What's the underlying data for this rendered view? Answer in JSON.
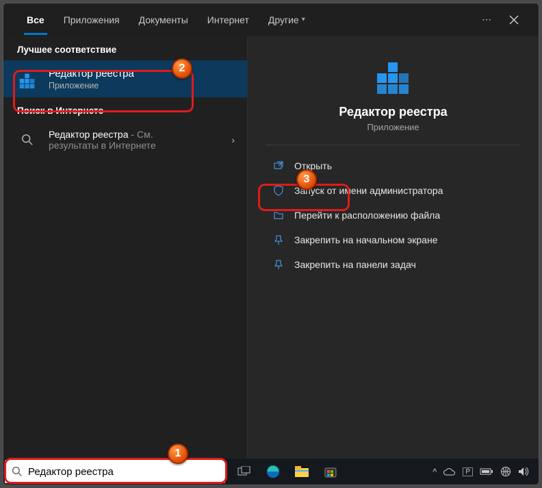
{
  "tabs": {
    "all": "Все",
    "apps": "Приложения",
    "docs": "Документы",
    "web": "Интернет",
    "other": "Другие"
  },
  "sections": {
    "best_match": "Лучшее соответствие",
    "web_search": "Поиск в Интернете"
  },
  "best_match": {
    "title": "Редактор реестра",
    "subtitle": "Приложение"
  },
  "web_result": {
    "title": "Редактор реестра",
    "dash": " - ",
    "suffix": "См.",
    "line2": "результаты в Интернете"
  },
  "preview": {
    "title": "Редактор реестра",
    "subtitle": "Приложение"
  },
  "actions": {
    "open": "Открыть",
    "run_admin": "Запуск от имени администратора",
    "file_location": "Перейти к расположению файла",
    "pin_start": "Закрепить на начальном экране",
    "pin_taskbar": "Закрепить на панели задач"
  },
  "search": {
    "value": "Редактор реестра"
  },
  "badges": {
    "b1": "1",
    "b2": "2",
    "b3": "3"
  }
}
